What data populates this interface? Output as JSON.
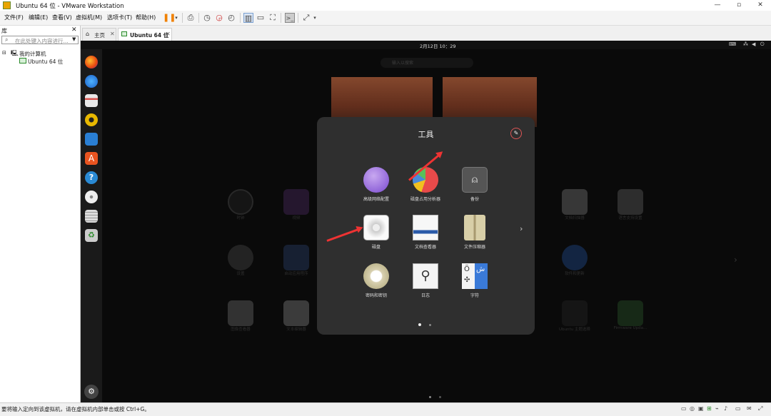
{
  "window": {
    "title": "Ubuntu 64 位 - VMware Workstation",
    "minimize": "—",
    "maximize": "▫",
    "close": "✕"
  },
  "menu": [
    "文件(F)",
    "编辑(E)",
    "查看(V)",
    "虚拟机(M)",
    "选项卡(T)",
    "帮助(H)"
  ],
  "library": {
    "title": "库",
    "close": "✕",
    "search_placeholder": "在此处键入内容进行...",
    "tree_root": "我的计算机",
    "tree_vm": "Ubuntu 64 位"
  },
  "tabs": [
    {
      "label": "主页"
    },
    {
      "label": "Ubuntu 64 位"
    }
  ],
  "vm": {
    "clock": "2月12日  10：29",
    "search_placeholder": "输入以搜索",
    "folder": {
      "title": "工具",
      "apps": [
        {
          "label": "高级网络配置",
          "icon": "advanced-network-icon"
        },
        {
          "label": "磁盘占用分析器",
          "icon": "disk-usage-analyzer-icon"
        },
        {
          "label": "备份",
          "icon": "backup-icon"
        },
        {
          "label": "磁盘",
          "icon": "disks-icon"
        },
        {
          "label": "文档查看器",
          "icon": "document-viewer-icon"
        },
        {
          "label": "文件压缩器",
          "icon": "file-archiver-icon"
        },
        {
          "label": "密码和密钥",
          "icon": "passwords-keys-icon"
        },
        {
          "label": "日志",
          "icon": "logs-icon"
        },
        {
          "label": "字符",
          "icon": "characters-icon"
        }
      ],
      "page_indicator": {
        "current": 1,
        "total": 2
      }
    },
    "background_apps": [
      {
        "label": "时钟"
      },
      {
        "label": "视频"
      },
      {
        "label": "文档扫描器"
      },
      {
        "label": "语言支持设置"
      },
      {
        "label": "设置"
      },
      {
        "label": "启动应用程序"
      },
      {
        "label": "软件和更新"
      },
      {
        "label": "图像查看器"
      },
      {
        "label": "文本编辑器"
      },
      {
        "label": "Ubuntu 主题选择"
      },
      {
        "label": "Firmware Upda..."
      }
    ]
  },
  "status": {
    "message": "要将输入定向到该虚拟机，请在虚拟机内部单击或按 Ctrl+G。"
  },
  "colors": {
    "accent_arrow": "#e33333",
    "pause": "#f08000",
    "vm_bg": "#0a0a0a",
    "folder_bg": "#2f2f2f"
  }
}
